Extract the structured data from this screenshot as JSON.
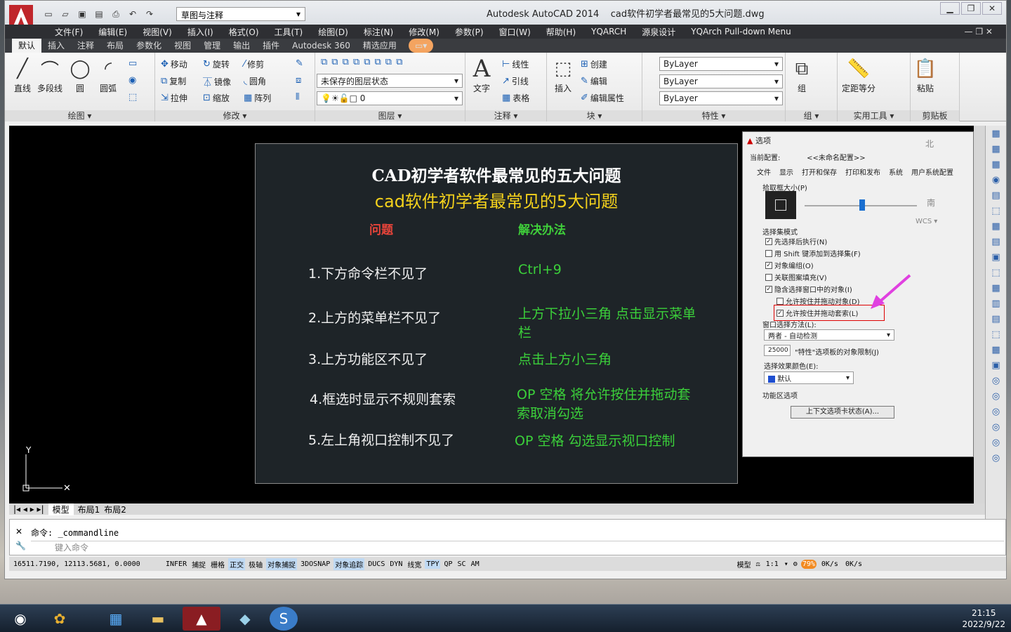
{
  "app": {
    "title": "Autodesk AutoCAD 2014",
    "file": "cad软件初学者最常见的5大问题.dwg",
    "workspace": "草图与注释"
  },
  "menu": [
    "文件(F)",
    "编辑(E)",
    "视图(V)",
    "插入(I)",
    "格式(O)",
    "工具(T)",
    "绘图(D)",
    "标注(N)",
    "修改(M)",
    "参数(P)",
    "窗口(W)",
    "帮助(H)",
    "YQARCH",
    "源泉设计",
    "YQArch Pull-down Menu"
  ],
  "tabs": [
    "默认",
    "插入",
    "注释",
    "布局",
    "参数化",
    "视图",
    "管理",
    "输出",
    "插件",
    "Autodesk 360",
    "精选应用"
  ],
  "ribbon": {
    "draw": {
      "title": "绘图",
      "line": "直线",
      "pline": "多段线",
      "circle": "圆",
      "arc": "圆弧"
    },
    "modify": {
      "title": "修改",
      "move": "移动",
      "rotate": "旋转",
      "trim": "修剪",
      "copy": "复制",
      "mirror": "镜像",
      "fillet": "圆角",
      "stretch": "拉伸",
      "scale": "缩放",
      "array": "阵列"
    },
    "layer": {
      "title": "图层",
      "state": "未保存的图层状态",
      "current": "0"
    },
    "annot": {
      "title": "注释",
      "text": "文字",
      "linear": "线性",
      "leader": "引线",
      "table": "表格"
    },
    "block": {
      "title": "块",
      "insert": "插入",
      "create": "创建",
      "edit": "编辑",
      "attr": "编辑属性"
    },
    "props": {
      "title": "特性",
      "color": "ByLayer",
      "linetype": "ByLayer",
      "lineweight": "ByLayer"
    },
    "group": {
      "title": "组",
      "label": "组"
    },
    "util": {
      "title": "实用工具",
      "measure": "定距等分"
    },
    "clip": {
      "title": "剪贴板",
      "paste": "粘贴"
    }
  },
  "slide": {
    "title1": "CAD初学者软件最常见的五大问题",
    "title2": "cad软件初学者最常见的5大问题",
    "h_problem": "问题",
    "h_solution": "解决办法",
    "rows": [
      {
        "q": "1.下方命令栏不见了",
        "a": "Ctrl+9"
      },
      {
        "q": "2.上方的菜单栏不见了",
        "a": "上方下拉小三角  点击显示菜单栏"
      },
      {
        "q": "3.上方功能区不见了",
        "a": "点击上方小三角"
      },
      {
        "q": "4.框选时显示不规则套索",
        "a": "OP 空格 将允许按住并拖动套索取消勾选"
      },
      {
        "q": "5.左上角视口控制不见了",
        "a": "OP 空格  勾选显示视口控制"
      }
    ]
  },
  "dialog": {
    "title": "选项",
    "profile_label": "当前配置:",
    "profile": "<<未命名配置>>",
    "tabs": [
      "文件",
      "显示",
      "打开和保存",
      "打印和发布",
      "系统",
      "用户系统配置"
    ],
    "pickbox": "拾取框大小(P)",
    "sel_modes": "选择集模式",
    "opts": [
      "先选择后执行(N)",
      "用 Shift 键添加到选择集(F)",
      "对象编组(O)",
      "关联图案填充(V)",
      "隐含选择窗口中的对象(I)",
      "允许按住并拖动对象(D)",
      "允许按住并拖动套索(L)"
    ],
    "window_method": "窗口选择方法(L):",
    "window_value": "两者 - 自动检测",
    "limit_value": "25000",
    "limit_label": "\"特性\"选项板的对象限制(J)",
    "effect_label": "选择效果颜色(E):",
    "effect_value": "默认",
    "ribbon_label": "功能区选项",
    "ribbon_btn": "上下文选项卡状态(A)...",
    "wcs": "WCS",
    "north": "北",
    "south": "南"
  },
  "layout_tabs": [
    "模型",
    "布局1",
    "布局2"
  ],
  "command": {
    "history": "命令: _commandline",
    "placeholder": "键入命令"
  },
  "status": {
    "coords": "16511.7190, 12113.5681, 0.0000",
    "toggles": [
      "INFER",
      "捕捉",
      "栅格",
      "正交",
      "极轴",
      "对象捕捉",
      "3DOSNAP",
      "对象追踪",
      "DUCS",
      "DYN",
      "线宽",
      "TPY",
      "QP",
      "SC",
      "AM"
    ],
    "model": "模型",
    "scale": "1:1",
    "net_pct": "79%",
    "up": "0K/s",
    "down": "0K/s"
  },
  "taskbar": {
    "time": "21:15",
    "date": "2022/9/22"
  }
}
